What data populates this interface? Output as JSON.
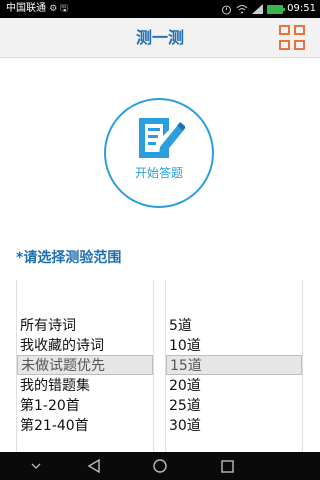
{
  "status_bar": {
    "carrier": "中国联通",
    "icons_left": "⚙ 🖫",
    "time": "09:51"
  },
  "header": {
    "title": "测一测"
  },
  "start": {
    "label": "开始答题"
  },
  "range": {
    "prompt": "*请选择测验范围",
    "options": [
      "所有诗词",
      "我收藏的诗词",
      "未做试题优先",
      "我的错题集",
      "第1-20首",
      "第21-40首"
    ],
    "selected_index": 2
  },
  "count": {
    "options": [
      "5道",
      "10道",
      "15道",
      "20道",
      "25道",
      "30道"
    ],
    "selected_index": 2
  },
  "colors": {
    "accent_blue": "#2b9fdb",
    "title_blue": "#1f6fb0",
    "menu_orange": "#e8733a"
  }
}
